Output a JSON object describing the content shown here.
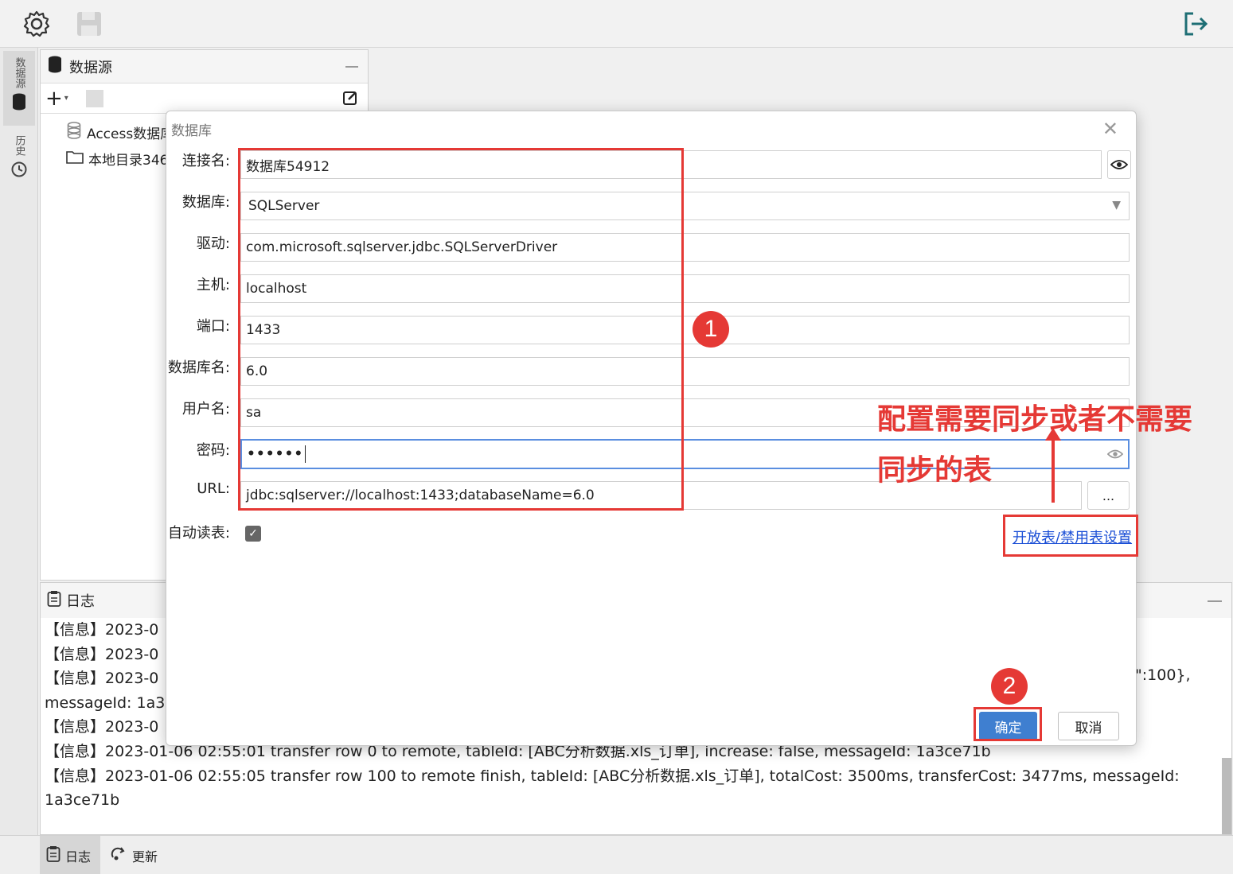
{
  "toolbar": {
    "settings_icon": "gear-icon",
    "save_icon": "save-icon",
    "logout_icon": "logout-icon"
  },
  "side_tabs": [
    {
      "label": "数据源",
      "icon": "database-icon"
    },
    {
      "label": "历史",
      "icon": "history-icon"
    }
  ],
  "datasource_panel": {
    "title": "数据源",
    "items": [
      {
        "label": "Access数据库",
        "icon": "database-icon"
      },
      {
        "label": "本地目录346",
        "icon": "folder-icon"
      }
    ]
  },
  "dialog": {
    "title": "数据库",
    "fields": {
      "conn_name": {
        "label": "连接名:",
        "value": "数据库54912"
      },
      "database": {
        "label": "数据库:",
        "value": "SQLServer"
      },
      "driver": {
        "label": "驱动:",
        "value": "com.microsoft.sqlserver.jdbc.SQLServerDriver"
      },
      "host": {
        "label": "主机:",
        "value": "localhost"
      },
      "port": {
        "label": "端口:",
        "value": "1433"
      },
      "db_name": {
        "label": "数据库名:",
        "value": "6.0"
      },
      "username": {
        "label": "用户名:",
        "value": "sa"
      },
      "password": {
        "label": "密码:",
        "value": "••••••"
      },
      "url": {
        "label": "URL:",
        "value": "jdbc:sqlserver://localhost:1433;databaseName=6.0"
      }
    },
    "auto_read": {
      "label": "自动读表:",
      "checked": true
    },
    "url_more": "...",
    "table_settings_link": "开放表/禁用表设置",
    "ok": "确定",
    "cancel": "取消"
  },
  "annotations": {
    "badge1": "1",
    "badge2": "2",
    "note_line1": "配置需要同步或者不需要",
    "note_line2": "同步的表"
  },
  "log": {
    "title": "日志",
    "lines": [
      "【信息】2023-0",
      "【信息】2023-0",
      "【信息】2023-0",
      "messageId: 1a3c",
      "【信息】2023-0",
      "【信息】2023-01-06 02:55:01 transfer row 0 to remote, tableId: [ABC分析数据.xls_订单], increase: false, messageId: 1a3ce71b",
      "【信息】2023-01-06 02:55:05 transfer row 100 to remote finish, tableId: [ABC分析数据.xls_订单], totalCost: 3500ms, transferCost: 3477ms, messageId:",
      "1a3ce71b"
    ],
    "partial_right": "\":100},"
  },
  "bottom_tabs": [
    {
      "label": "日志",
      "icon": "clipboard-icon"
    },
    {
      "label": "更新",
      "icon": "update-icon"
    }
  ]
}
